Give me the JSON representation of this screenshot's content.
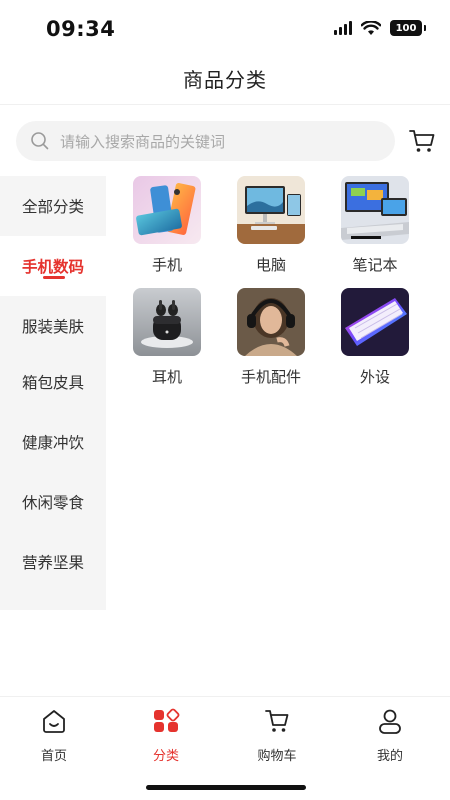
{
  "status_bar": {
    "time": "09:34",
    "battery": "100"
  },
  "header": {
    "title": "商品分类"
  },
  "search": {
    "placeholder": "请输入搜索商品的关键词",
    "icon": "search-icon"
  },
  "header_cart_icon": "cart-icon",
  "sidebar": {
    "items": [
      {
        "label": "全部分类"
      },
      {
        "label": "手机数码"
      },
      {
        "label": "服装美肤"
      },
      {
        "label": "箱包皮具"
      },
      {
        "label": "健康冲饮"
      },
      {
        "label": "休闲零食"
      },
      {
        "label": "营养坚果"
      }
    ],
    "active_index": 1
  },
  "products": [
    {
      "label": "手机",
      "image": "phones-image"
    },
    {
      "label": "电脑",
      "image": "desktop-computer-image"
    },
    {
      "label": "笔记本",
      "image": "laptop-image"
    },
    {
      "label": "耳机",
      "image": "earbuds-image"
    },
    {
      "label": "手机配件",
      "image": "headphones-person-image"
    },
    {
      "label": "外设",
      "image": "keyboard-image"
    }
  ],
  "tabbar": {
    "items": [
      {
        "label": "首页",
        "icon": "home-icon"
      },
      {
        "label": "分类",
        "icon": "category-icon"
      },
      {
        "label": "购物车",
        "icon": "cart-icon"
      },
      {
        "label": "我的",
        "icon": "user-icon"
      }
    ],
    "active_index": 1
  },
  "colors": {
    "accent": "#e5332e",
    "sidebar_bg": "#f5f5f5",
    "search_bg": "#f3f3f3"
  }
}
